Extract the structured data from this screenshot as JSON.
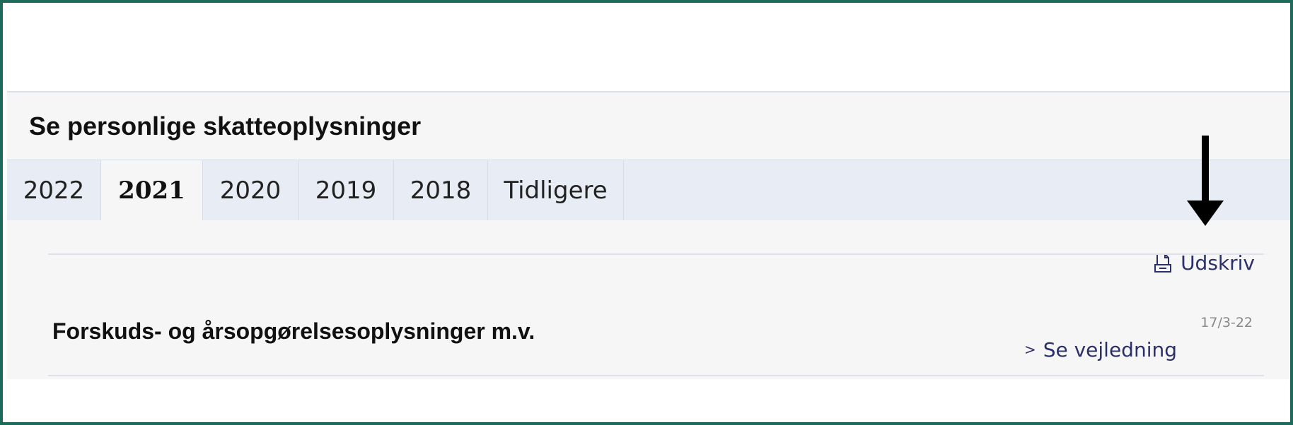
{
  "page_title": "Se personlige skatteoplysninger",
  "tabs": [
    {
      "label": "2022",
      "active": false
    },
    {
      "label": "2021",
      "active": true
    },
    {
      "label": "2020",
      "active": false
    },
    {
      "label": "2019",
      "active": false
    },
    {
      "label": "2018",
      "active": false
    },
    {
      "label": "Tidligere",
      "active": false
    }
  ],
  "print": {
    "label": "Udskriv",
    "icon": "print-document-icon"
  },
  "section": {
    "title": "Forskuds- og årsopgørelsesoplysninger m.v.",
    "date": "17/3-22",
    "guide_link_label": "Se vejledning",
    "guide_link_icon": "chevron-right-icon"
  },
  "annotation": {
    "icon": "down-arrow-icon"
  },
  "colors": {
    "frame_border": "#1f6b5b",
    "link": "#2b2f6b",
    "tabbar_bg": "#e8ecf4",
    "panel_bg": "#f6f6f6"
  }
}
